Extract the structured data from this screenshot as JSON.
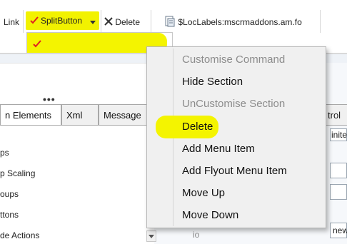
{
  "toolbar": {
    "link_label": "Link",
    "split_button_label": "SplitButton",
    "delete_label": "Delete",
    "loc_label": "$LocLabels:mscrmaddons.am.fo"
  },
  "left_panel": {
    "tabs": [
      "n Elements",
      "Xml",
      "Message"
    ],
    "tree_items": [
      "ps",
      "p Scaling",
      "oups",
      "ttons",
      "de Actions"
    ]
  },
  "right_panel": {
    "tab_label": "trol",
    "field_text": "inite",
    "bottom_text": "new",
    "small_text": "io"
  },
  "context_menu": {
    "items": [
      {
        "label": "Customise Command",
        "enabled": false
      },
      {
        "label": "Hide Section",
        "enabled": true
      },
      {
        "label": "UnCustomise Section",
        "enabled": false
      },
      {
        "label": "Delete",
        "enabled": true,
        "highlighted": true
      },
      {
        "label": "Add Menu Item",
        "enabled": true
      },
      {
        "label": "Add Flyout Menu Item",
        "enabled": true
      },
      {
        "label": "Move Up",
        "enabled": true
      },
      {
        "label": "Move Down",
        "enabled": true
      }
    ]
  },
  "colors": {
    "highlight": "#f4f400",
    "checkmark": "#e02020"
  }
}
